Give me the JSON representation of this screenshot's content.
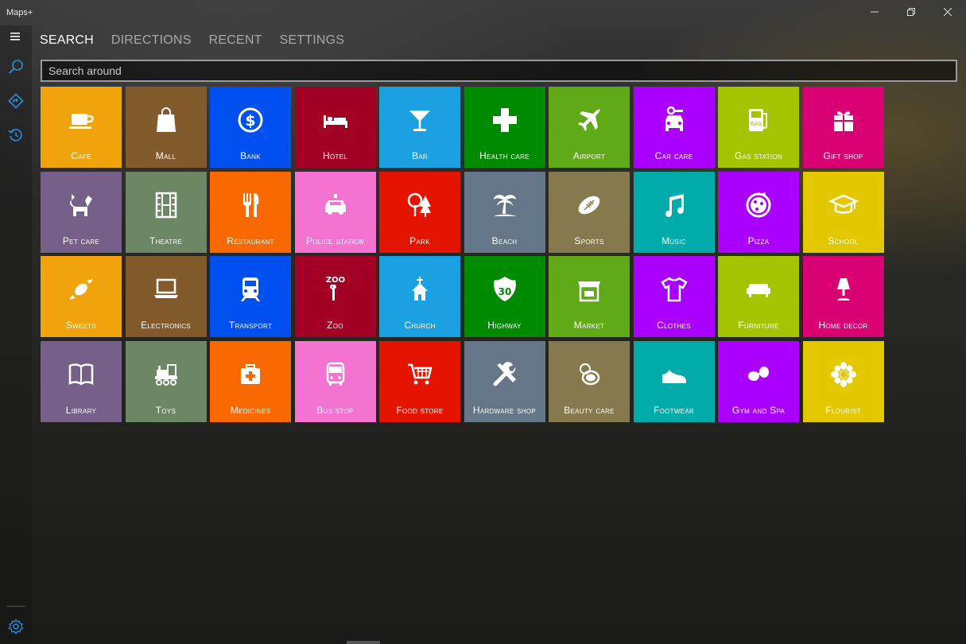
{
  "app": {
    "title": "Maps+"
  },
  "window_controls": {
    "minimize": "—",
    "restore": "⧉",
    "close": "✕"
  },
  "sidebar": {
    "items": [
      {
        "name": "menu",
        "icon": "hamburger-icon"
      },
      {
        "name": "search",
        "icon": "search-icon"
      },
      {
        "name": "directions",
        "icon": "directions-icon"
      },
      {
        "name": "recent",
        "icon": "history-icon"
      }
    ],
    "settings_icon": "gear-icon"
  },
  "tabs": [
    {
      "label": "SEARCH",
      "active": true
    },
    {
      "label": "DIRECTIONS",
      "active": false
    },
    {
      "label": "RECENT",
      "active": false
    },
    {
      "label": "SETTINGS",
      "active": false
    }
  ],
  "search": {
    "placeholder": "Search around",
    "value": ""
  },
  "tiles": [
    {
      "label": "Cafe",
      "icon": "coffee-cup-icon",
      "color": "#F0A30A"
    },
    {
      "label": "Mall",
      "icon": "shopping-bag-icon",
      "color": "#825A2C"
    },
    {
      "label": "Bank",
      "icon": "dollar-coin-icon",
      "color": "#0050EF"
    },
    {
      "label": "Hotel",
      "icon": "bed-icon",
      "color": "#A20025"
    },
    {
      "label": "Bar",
      "icon": "cocktail-glass-icon",
      "color": "#1BA1E2"
    },
    {
      "label": "Health care",
      "icon": "medical-cross-icon",
      "color": "#008A00"
    },
    {
      "label": "Airport",
      "icon": "airplane-icon",
      "color": "#60A917"
    },
    {
      "label": "Car care",
      "icon": "car-wrench-icon",
      "color": "#AA00FF"
    },
    {
      "label": "Gas station",
      "icon": "gas-pump-icon",
      "color": "#A4C400"
    },
    {
      "label": "Gift shop",
      "icon": "gift-icon",
      "color": "#D80073"
    },
    {
      "label": "Pet care",
      "icon": "dog-icon",
      "color": "#76608A"
    },
    {
      "label": "Theatre",
      "icon": "film-strip-icon",
      "color": "#6D8764"
    },
    {
      "label": "Restaurant",
      "icon": "fork-knife-icon",
      "color": "#FA6800"
    },
    {
      "label": "Police station",
      "icon": "police-car-icon",
      "color": "#F472D0"
    },
    {
      "label": "Park",
      "icon": "trees-icon",
      "color": "#E51400"
    },
    {
      "label": "Beach",
      "icon": "palm-tree-icon",
      "color": "#647687"
    },
    {
      "label": "Sports",
      "icon": "football-icon",
      "color": "#87794E"
    },
    {
      "label": "Music",
      "icon": "music-note-icon",
      "color": "#00ABA9"
    },
    {
      "label": "Pizza",
      "icon": "pizza-icon",
      "color": "#AA00FF"
    },
    {
      "label": "School",
      "icon": "graduation-cap-icon",
      "color": "#E3C800"
    },
    {
      "label": "Sweets",
      "icon": "candy-icon",
      "color": "#F0A30A"
    },
    {
      "label": "Electronics",
      "icon": "laptop-icon",
      "color": "#825A2C"
    },
    {
      "label": "Transport",
      "icon": "train-icon",
      "color": "#0050EF"
    },
    {
      "label": "Zoo",
      "icon": "giraffe-icon",
      "color": "#A20025"
    },
    {
      "label": "Church",
      "icon": "church-icon",
      "color": "#1BA1E2"
    },
    {
      "label": "Highway",
      "icon": "highway-shield-icon",
      "color": "#008A00"
    },
    {
      "label": "Market",
      "icon": "market-stall-icon",
      "color": "#60A917"
    },
    {
      "label": "Clothes",
      "icon": "tshirt-icon",
      "color": "#AA00FF"
    },
    {
      "label": "Furniture",
      "icon": "sofa-icon",
      "color": "#A4C400"
    },
    {
      "label": "Home decor",
      "icon": "lamp-icon",
      "color": "#D80073"
    },
    {
      "label": "Library",
      "icon": "open-book-icon",
      "color": "#76608A"
    },
    {
      "label": "Toys",
      "icon": "toy-train-icon",
      "color": "#6D8764"
    },
    {
      "label": "Medicines",
      "icon": "first-aid-kit-icon",
      "color": "#FA6800"
    },
    {
      "label": "Bus stop",
      "icon": "bus-icon",
      "color": "#F472D0"
    },
    {
      "label": "Food store",
      "icon": "shopping-cart-icon",
      "color": "#E51400"
    },
    {
      "label": "Hardware shop",
      "icon": "tools-icon",
      "color": "#647687"
    },
    {
      "label": "Beauty care",
      "icon": "compact-mirror-icon",
      "color": "#87794E"
    },
    {
      "label": "Footwear",
      "icon": "shoe-icon",
      "color": "#00ABA9"
    },
    {
      "label": "Gym and Spa",
      "icon": "dumbbell-icon",
      "color": "#AA00FF"
    },
    {
      "label": "Flourist",
      "icon": "flower-icon",
      "color": "#E3C800"
    }
  ]
}
